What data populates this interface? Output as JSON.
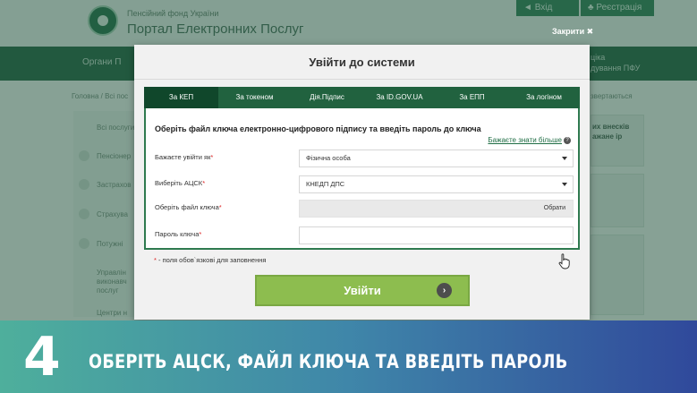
{
  "background": {
    "fund_name": "Пенсійний фонд України",
    "portal_title": "Портал Електронних Послуг",
    "login_label": "Вхід",
    "register_label": "Реєстрація",
    "close_label": "Закрити ✖",
    "nav_left": "Органи П",
    "nav_right_1": "ціка",
    "nav_right_2": "дування ПФУ",
    "breadcrumb": "Головна / Всі пос",
    "breadcrumb_right": "звертаються",
    "sidebar_items": [
      "Всі послуги",
      "Пенсіонер",
      "Застрахов",
      "Страхува",
      "Потужні",
      "Управлін виконавч послуг",
      "Центри н"
    ],
    "right_card_text": "их внесків ажане ір"
  },
  "modal": {
    "title": "Увійти до системи",
    "tabs": [
      {
        "label": "За КЕП",
        "active": true
      },
      {
        "label": "За токеном",
        "active": false
      },
      {
        "label": "Дія.Підпис",
        "active": false
      },
      {
        "label": "За ID.GOV.UA",
        "active": false
      },
      {
        "label": "За ЕПП",
        "active": false
      },
      {
        "label": "За логіном",
        "active": false
      }
    ],
    "heading": "Оберіть файл ключа електронно-цифрового підпису та введіть пароль до ключа",
    "help_link": "Бажаєте знати більше",
    "fields": {
      "role_label": "Бажаєте увійти як",
      "role_value": "Фізична особа",
      "acsk_label": "Виберіть АЦСК",
      "acsk_value": "КНЕДП ДПС",
      "key_file_label": "Оберіть файл ключа",
      "key_file_value": "",
      "browse_label": "Обрати",
      "password_label": "Пароль ключа",
      "password_value": ""
    },
    "required_note": " - поля обов`язкові для заповнення",
    "required_mark": "*",
    "submit_label": "Увійти",
    "submit_arrow": "›"
  },
  "caption": {
    "step_number": "4",
    "text": "ОБЕРІТЬ АЦСК, ФАЙЛ КЛЮЧА ТА ВВЕДІТЬ ПАРОЛЬ"
  },
  "colors": {
    "tab_bar": "#21623f",
    "tab_active": "#10472b",
    "submit_button": "#8dbd4f",
    "required": "#d22222"
  }
}
